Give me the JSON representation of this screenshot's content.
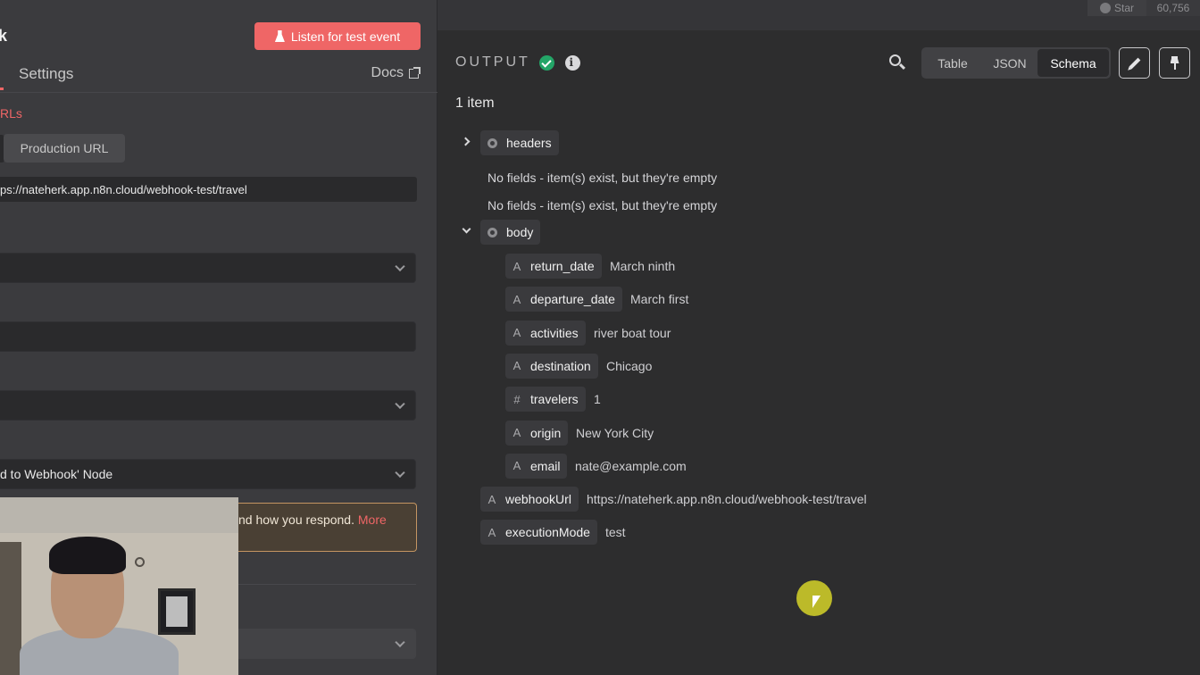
{
  "topbar": {
    "star_label": "Star",
    "star_count": "60,756"
  },
  "params": {
    "title_fragment": "k",
    "listen_button": "Listen for test event",
    "tab_settings": "Settings",
    "docs_label": "Docs",
    "urls_label": "RLs",
    "production_url_button": "Production URL",
    "webhook_url": "ps://nateherk.app.n8n.cloud/webhook-test/travel",
    "respond_select": "d to Webhook' Node",
    "notice_text": "nd how you respond.",
    "notice_more": "More"
  },
  "output": {
    "title": "OUTPUT",
    "info_glyph": "i",
    "views": {
      "table": "Table",
      "json": "JSON",
      "schema": "Schema"
    },
    "item_count": "1 item",
    "headers_key": "headers",
    "empty_note_1": "No fields - item(s) exist, but they're empty",
    "empty_note_2": "No fields - item(s) exist, but they're empty",
    "body_key": "body",
    "fields": [
      {
        "type": "A",
        "key": "return_date",
        "value": "March ninth"
      },
      {
        "type": "A",
        "key": "departure_date",
        "value": "March first"
      },
      {
        "type": "A",
        "key": "activities",
        "value": "river boat tour"
      },
      {
        "type": "A",
        "key": "destination",
        "value": "Chicago"
      },
      {
        "type": "#",
        "key": "travelers",
        "value": "1"
      },
      {
        "type": "A",
        "key": "origin",
        "value": "New York City"
      },
      {
        "type": "A",
        "key": "email",
        "value": "nate@example.com"
      }
    ],
    "root_fields": [
      {
        "type": "A",
        "key": "webhookUrl",
        "value": "https://nateherk.app.n8n.cloud/webhook-test/travel"
      },
      {
        "type": "A",
        "key": "executionMode",
        "value": "test"
      }
    ]
  },
  "colors": {
    "accent": "#ef6666",
    "success": "#23a567",
    "panel": "#3b3b3e",
    "background": "#2d2d2e"
  }
}
